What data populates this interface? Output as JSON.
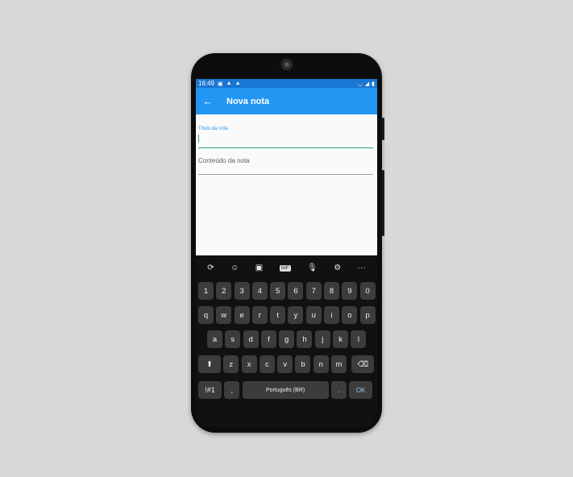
{
  "status_bar": {
    "time": "16:49",
    "icons": [
      "image-icon",
      "warning-icon",
      "warning-icon"
    ],
    "right_icons": [
      "wifi-icon",
      "signal-icon",
      "battery-icon"
    ]
  },
  "app_bar": {
    "title": "Nova nota",
    "back_icon": "←"
  },
  "form": {
    "title_label": "Título da nota",
    "content_placeholder": "Conteúdo da nota"
  },
  "keyboard": {
    "toolbar": [
      "⟳",
      "☺",
      "▣",
      "GIF",
      "🎙",
      "⚙",
      "···"
    ],
    "numbers": [
      "1",
      "2",
      "3",
      "4",
      "5",
      "6",
      "7",
      "8",
      "9",
      "0"
    ],
    "row1": [
      "q",
      "w",
      "e",
      "r",
      "t",
      "y",
      "u",
      "i",
      "o",
      "p"
    ],
    "row2": [
      "a",
      "s",
      "d",
      "f",
      "g",
      "h",
      "j",
      "k",
      "l"
    ],
    "row3": [
      "z",
      "x",
      "c",
      "v",
      "b",
      "n",
      "m"
    ],
    "shift": "⬆",
    "backspace": "⌫",
    "sym": "!#1",
    "comma": ",",
    "space": "Português (BR)",
    "period": ".",
    "ok": "OK"
  },
  "colors": {
    "status_bar": "#1976d2",
    "app_bar": "#2196f3",
    "focus_line": "#2aa37b",
    "background": "#d9d7d7"
  }
}
